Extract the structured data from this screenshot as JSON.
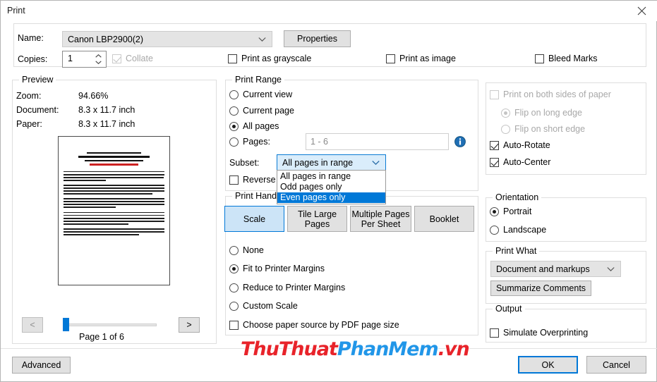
{
  "window": {
    "title": "Print",
    "close_icon": "close-icon"
  },
  "printer": {
    "name_label": "Name:",
    "name_value": "Canon LBP2900(2)",
    "properties_button": "Properties",
    "copies_label": "Copies:",
    "copies_value": "1",
    "collate_label": "Collate",
    "collate_checked": true,
    "collate_enabled": false,
    "print_as_grayscale_label": "Print as grayscale",
    "print_as_image_label": "Print as image",
    "bleed_marks_label": "Bleed Marks"
  },
  "preview": {
    "legend": "Preview",
    "zoom_label": "Zoom:",
    "zoom_value": "94.66%",
    "document_label": "Document:",
    "document_value": "8.3 x 11.7 inch",
    "paper_label": "Paper:",
    "paper_value": "8.3 x 11.7 inch",
    "prev_button": "<",
    "next_button": ">",
    "page_status": "Page 1 of 6"
  },
  "print_range": {
    "legend": "Print Range",
    "options": [
      {
        "label": "Current view",
        "selected": false
      },
      {
        "label": "Current page",
        "selected": false
      },
      {
        "label": "All pages",
        "selected": true
      },
      {
        "label": "Pages:",
        "selected": false
      }
    ],
    "pages_value": "1 - 6",
    "info_icon": "info-icon",
    "subset_label": "Subset:",
    "subset_value": "All pages in range",
    "subset_options": [
      "All pages in range",
      "Odd pages only",
      "Even pages only"
    ],
    "subset_highlighted": "Even pages only",
    "reverse_pages_label": "Reverse pages"
  },
  "print_handling": {
    "legend": "Print Handling",
    "tabs": [
      {
        "label": "Scale",
        "active": true
      },
      {
        "label": "Tile Large Pages",
        "active": false
      },
      {
        "label": "Multiple Pages Per Sheet",
        "active": false
      },
      {
        "label": "Booklet",
        "active": false
      }
    ],
    "scale_options": [
      {
        "label": "None",
        "selected": false
      },
      {
        "label": "Fit to Printer Margins",
        "selected": true
      },
      {
        "label": "Reduce to Printer Margins",
        "selected": false
      },
      {
        "label": "Custom Scale",
        "selected": false
      }
    ],
    "paper_source_label": "Choose paper source by PDF page size"
  },
  "duplex": {
    "both_sides_label": "Print on both sides of paper",
    "flip_long_label": "Flip on long edge",
    "flip_short_label": "Flip on short edge",
    "auto_rotate_label": "Auto-Rotate",
    "auto_center_label": "Auto-Center"
  },
  "orientation": {
    "legend": "Orientation",
    "options": [
      {
        "label": "Portrait",
        "selected": true
      },
      {
        "label": "Landscape",
        "selected": false
      }
    ]
  },
  "print_what": {
    "legend": "Print What",
    "value": "Document and markups",
    "summarize_button": "Summarize Comments"
  },
  "output": {
    "legend": "Output",
    "simulate_overprinting_label": "Simulate Overprinting"
  },
  "footer": {
    "advanced_button": "Advanced",
    "ok_button": "OK",
    "cancel_button": "Cancel"
  },
  "watermark": {
    "part1": "ThuThuat",
    "part2": "PhanMem",
    "part3": ".vn",
    "color_red": "#e8232a",
    "color_blue": "#2196e8"
  },
  "colors": {
    "accent": "#0078d7",
    "tab_active_fill": "#cce4f7",
    "highlight": "#0078d7"
  }
}
